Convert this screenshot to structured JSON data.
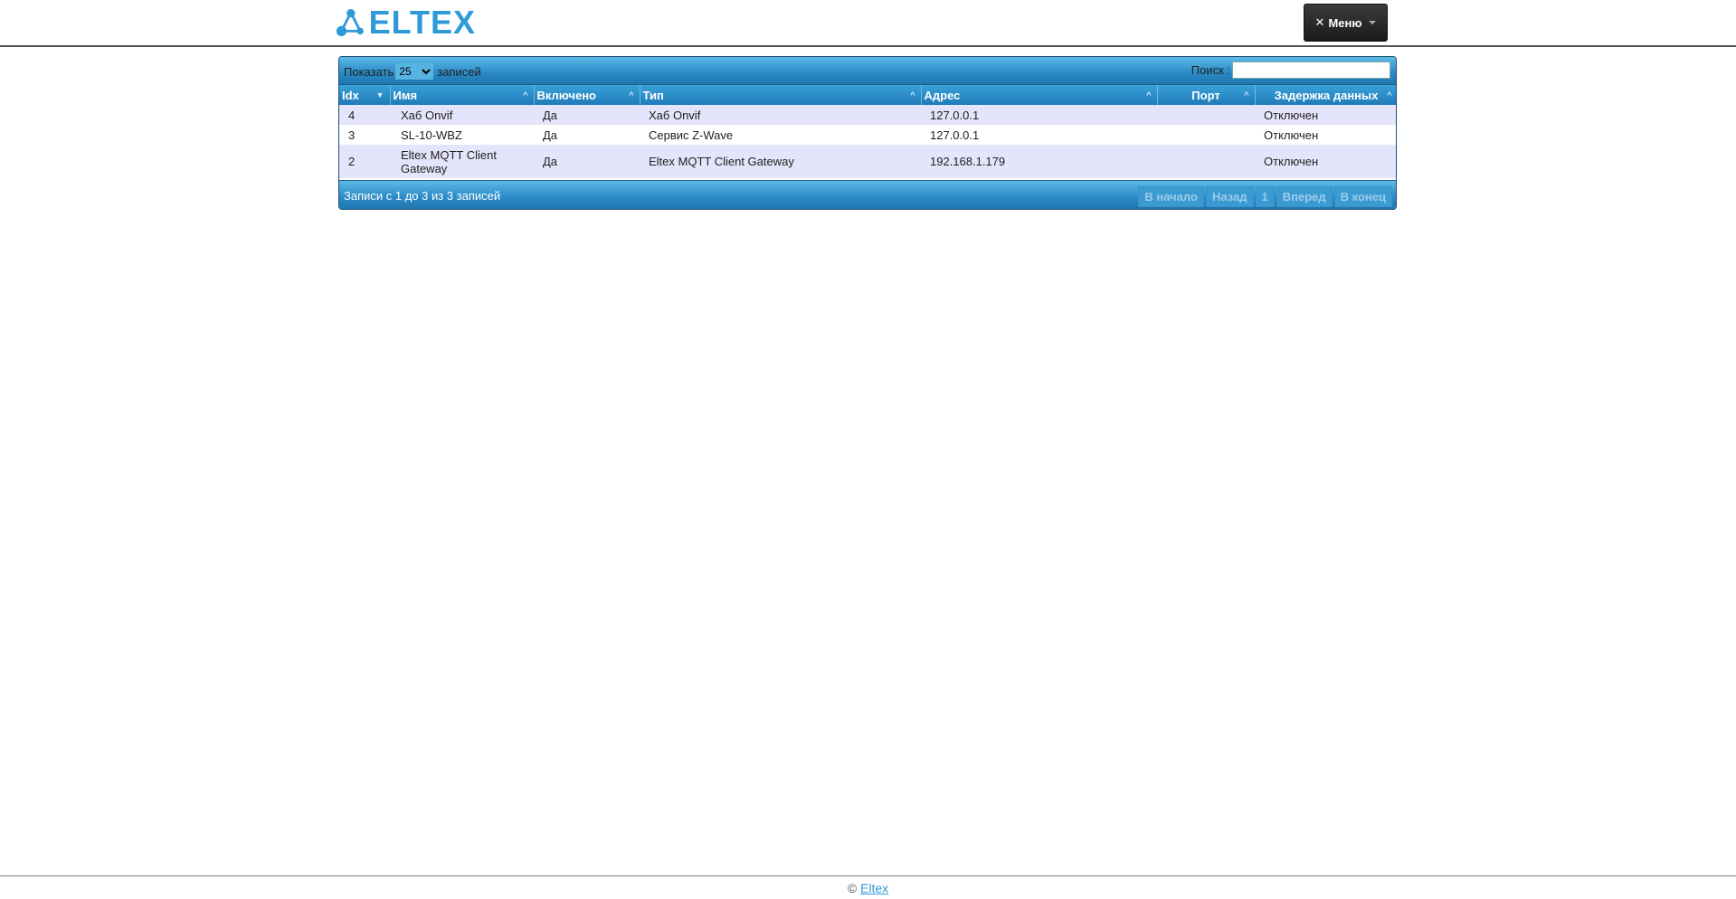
{
  "header": {
    "logo_text": "ELTEX",
    "menu_label": "Меню",
    "brand_color": "#2e9ad8"
  },
  "toolbar": {
    "show_label": "Показать",
    "page_length": "25",
    "records_label": "записей",
    "search_label": "Поиск :",
    "search_value": ""
  },
  "table": {
    "columns": [
      "Idx",
      "Имя",
      "Включено",
      "Тип",
      "Адрес",
      "Порт",
      "Задержка данных"
    ],
    "rows": [
      {
        "idx": "4",
        "name": "Хаб Onvif",
        "enabled": "Да",
        "type": "Хаб Onvif",
        "address": "127.0.0.1",
        "port": "",
        "delay": "Отключен"
      },
      {
        "idx": "3",
        "name": "SL-10-WBZ",
        "enabled": "Да",
        "type": "Сервис Z-Wave",
        "address": "127.0.0.1",
        "port": "",
        "delay": "Отключен"
      },
      {
        "idx": "2",
        "name": "Eltex MQTT Client Gateway",
        "enabled": "Да",
        "type": "Eltex MQTT Client Gateway",
        "address": "192.168.1.179",
        "port": "",
        "delay": "Отключен"
      }
    ]
  },
  "footer_bar": {
    "info": "Записи с 1 до 3 из 3 записей",
    "first": "В начало",
    "prev": "Назад",
    "page": "1",
    "next": "Вперед",
    "last": "В конец"
  },
  "page_footer": {
    "copyright": "©",
    "link": "Eltex"
  }
}
